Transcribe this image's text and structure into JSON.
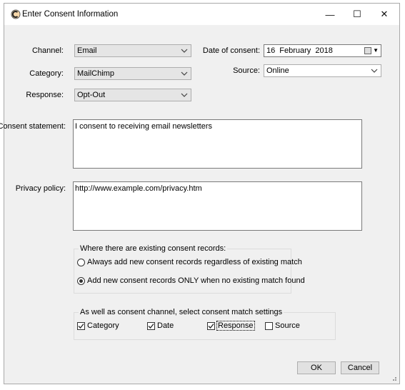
{
  "window": {
    "title": "Enter Consent Information",
    "controls": {
      "minimize": "—",
      "maximize": "☐",
      "close": "✕"
    }
  },
  "form": {
    "channel": {
      "label": "Channel:",
      "value": "Email"
    },
    "category": {
      "label": "Category:",
      "value": "MailChimp"
    },
    "response": {
      "label": "Response:",
      "value": "Opt-Out"
    },
    "date_of_consent": {
      "label": "Date of consent:",
      "value": "16  February  2018"
    },
    "source": {
      "label": "Source:",
      "value": "Online"
    },
    "consent_statement": {
      "label": "Consent statement:",
      "value": "I consent to receiving email newsletters"
    },
    "privacy_policy": {
      "label": "Privacy policy:",
      "value": "http://www.example.com/privacy.htm"
    }
  },
  "existing_records": {
    "title": "Where there are existing consent records:",
    "options": [
      {
        "label": "Always add new consent records regardless of existing match",
        "selected": false
      },
      {
        "label": "Add new consent records ONLY when no existing match found",
        "selected": true
      }
    ]
  },
  "match_settings": {
    "title": "As well as consent channel, select consent match settings",
    "checks": [
      {
        "label": "Category",
        "checked": true
      },
      {
        "label": "Date",
        "checked": true
      },
      {
        "label": "Response",
        "checked": true
      },
      {
        "label": "Source",
        "checked": false
      }
    ]
  },
  "buttons": {
    "ok": "OK",
    "cancel": "Cancel"
  }
}
